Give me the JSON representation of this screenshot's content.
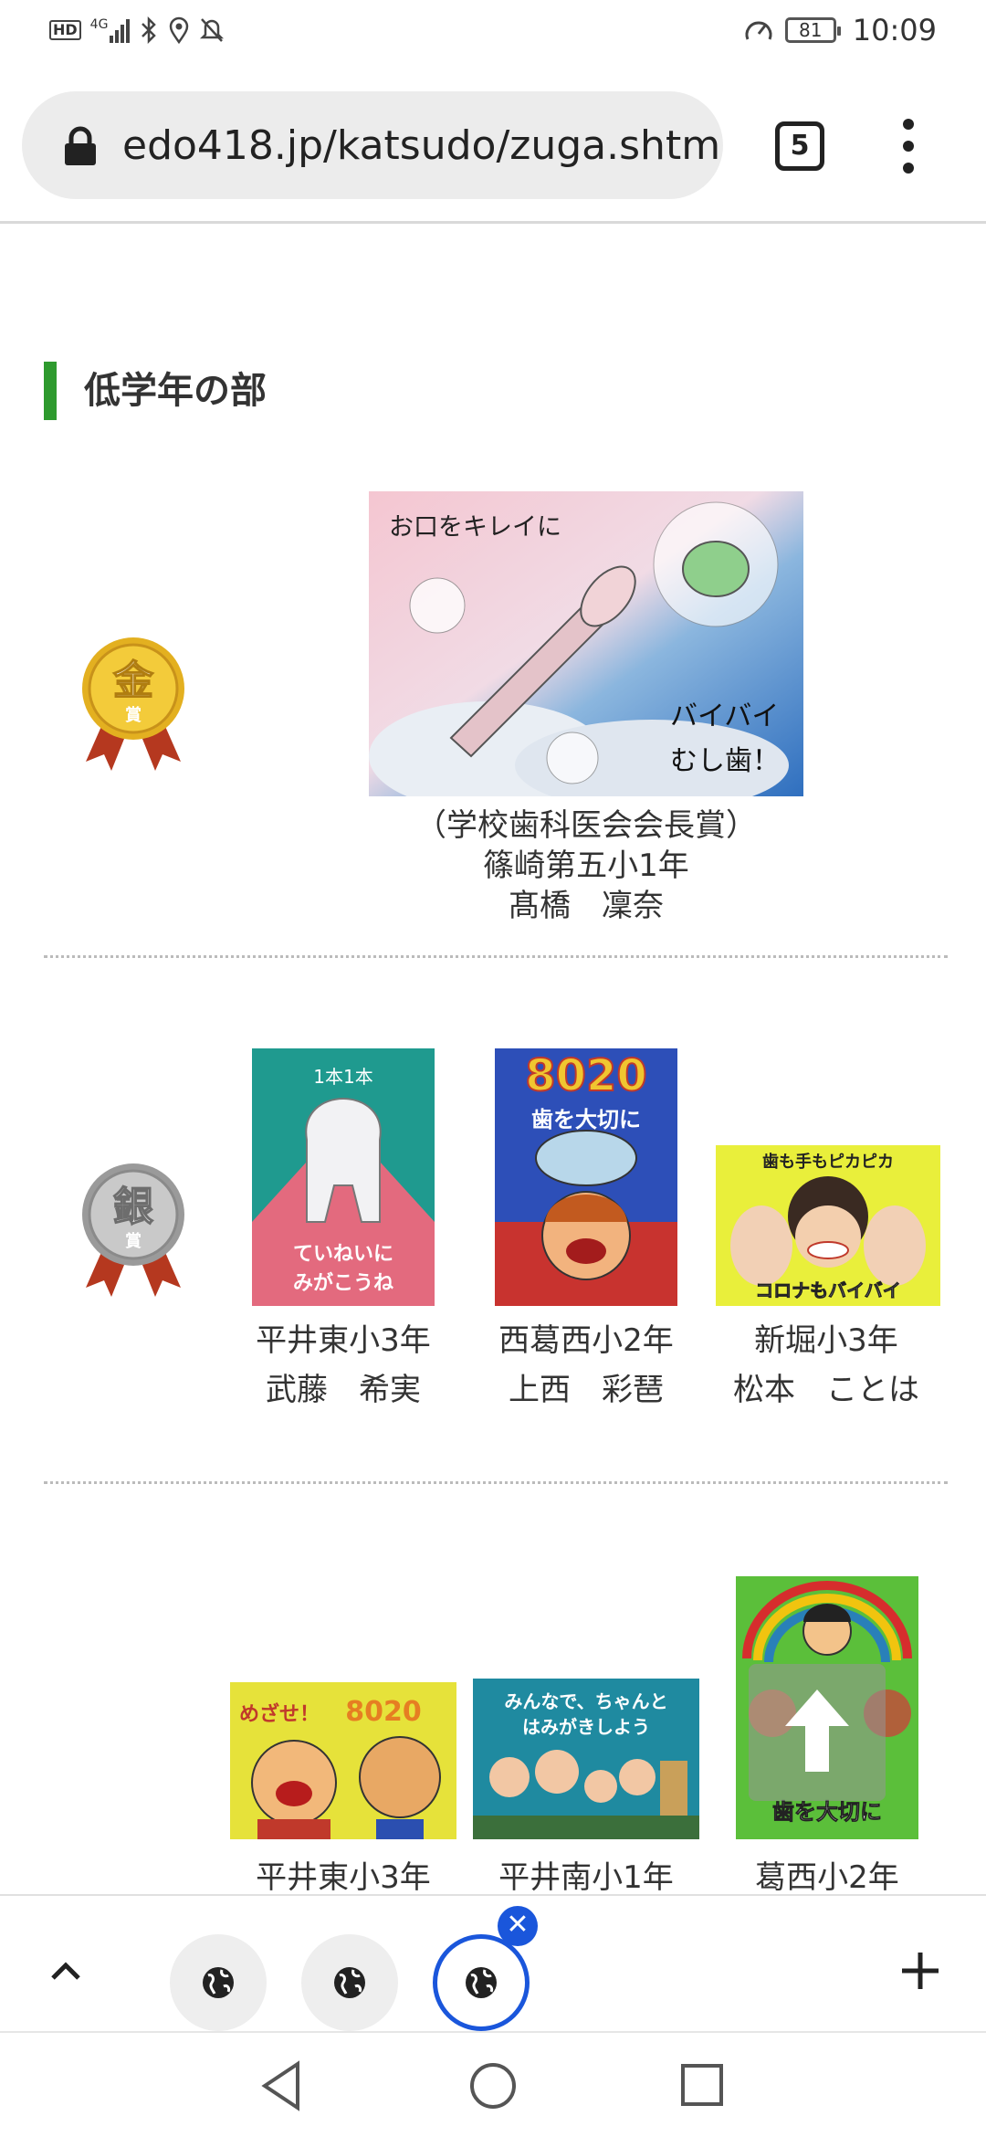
{
  "status_bar": {
    "left_icons": [
      "hd-icon",
      "signal-4g-icon",
      "bluetooth-icon",
      "location-icon",
      "mute-icon"
    ],
    "net_label": "HD",
    "net_type": "4G",
    "battery": "81",
    "time": "10:09"
  },
  "browser": {
    "url": "edo418.jp/katsudo/zuga.shtm",
    "tab_count": "5"
  },
  "section": {
    "title": "低学年の部"
  },
  "gold": {
    "medal_char": "金",
    "medal_sub": "賞",
    "artwork_text": [
      "お口をキレイに",
      "バイバイ",
      "むし歯！"
    ],
    "caption": [
      "（学校歯科医会会長賞）",
      "篠崎第五小1年",
      "髙橋　凜奈"
    ]
  },
  "silver": {
    "medal_char": "銀",
    "medal_sub": "賞",
    "entries": [
      {
        "school": "平井東小3年",
        "name": "武藤　希実",
        "art_text": [
          "1本1本",
          "ていねいに",
          "みがこうね"
        ]
      },
      {
        "school": "西葛西小2年",
        "name": "上西　彩琶",
        "art_text": [
          "8020",
          "歯を大切に"
        ]
      },
      {
        "school": "新堀小3年",
        "name": "松本　ことは",
        "art_text": [
          "歯も手もピカピカ",
          "コロナもバイバイ"
        ]
      }
    ]
  },
  "bronze": {
    "entries": [
      {
        "school": "平井東小3年",
        "art_text": [
          "めざせ！",
          "8020"
        ]
      },
      {
        "school": "平井南小1年",
        "art_text": [
          "みんなで、ちゃんと",
          "はみがきしよう"
        ]
      },
      {
        "school": "葛西小2年",
        "art_text": [
          "歯を大切に"
        ]
      }
    ]
  },
  "bottom_bar": {
    "up_icon": "chevron-up-icon",
    "tabs": [
      "tab-1",
      "tab-2",
      "tab-3"
    ],
    "add_icon": "plus-icon"
  },
  "nav_bar": [
    "back-icon",
    "home-icon",
    "recents-icon"
  ],
  "colors": {
    "accent_green": "#2e9a2e",
    "active_blue": "#1a56db",
    "gold": "#d4a017",
    "silver": "#a8a8a8"
  }
}
